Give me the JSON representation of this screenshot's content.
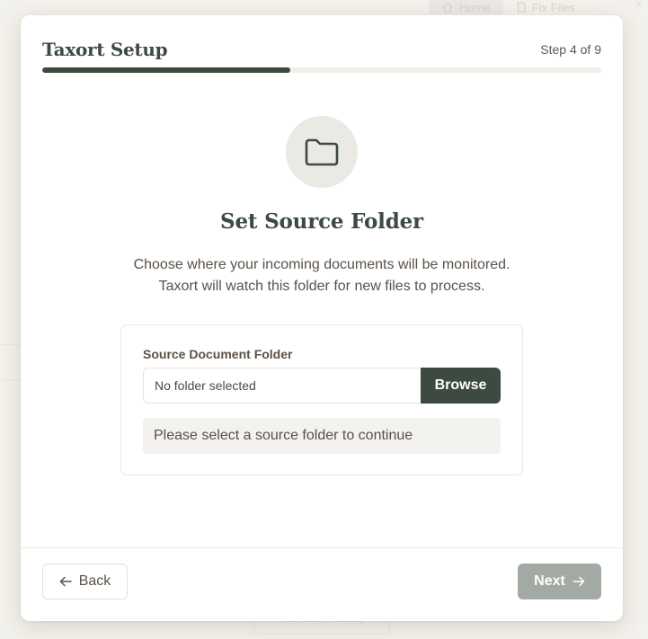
{
  "background": {
    "nav_tabs": [
      {
        "label": "Home",
        "icon": "home-icon"
      },
      {
        "label": "Fix Files",
        "icon": "file-icon"
      }
    ],
    "close_glyph": "×",
    "bottom_button": "Refresh Activity"
  },
  "wizard": {
    "title": "Taxort Setup",
    "step_text": "Step 4 of 9",
    "progress_fraction": 0.444,
    "icon": "folder-icon",
    "heading": "Set Source Folder",
    "description_line1": "Choose where your incoming documents will be monitored.",
    "description_line2": "Taxort will watch this folder for new files to process.",
    "field": {
      "label": "Source Document Folder",
      "value": "No folder selected",
      "browse_label": "Browse",
      "validation_message": "Please select a source folder to continue"
    },
    "footer": {
      "back_label": "Back",
      "next_label": "Next"
    }
  },
  "colors": {
    "accent": "#3d4a40",
    "disabled_button": "#a3aaa3",
    "background": "#f3f1ec"
  }
}
